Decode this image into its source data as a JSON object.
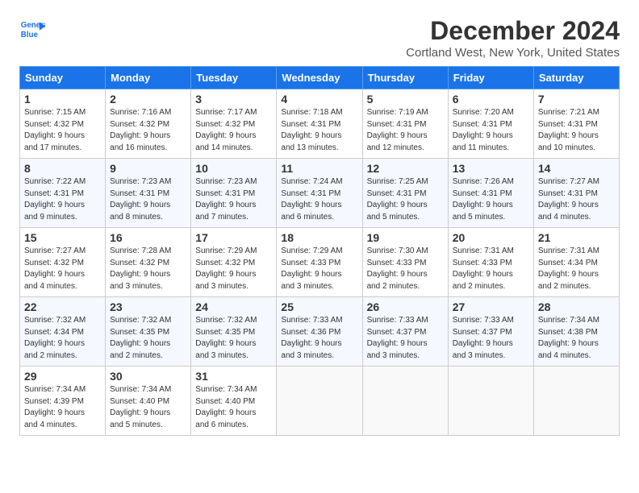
{
  "logo": {
    "line1": "General",
    "line2": "Blue"
  },
  "title": "December 2024",
  "subtitle": "Cortland West, New York, United States",
  "days_of_week": [
    "Sunday",
    "Monday",
    "Tuesday",
    "Wednesday",
    "Thursday",
    "Friday",
    "Saturday"
  ],
  "weeks": [
    [
      {
        "day": 1,
        "info": "Sunrise: 7:15 AM\nSunset: 4:32 PM\nDaylight: 9 hours\nand 17 minutes."
      },
      {
        "day": 2,
        "info": "Sunrise: 7:16 AM\nSunset: 4:32 PM\nDaylight: 9 hours\nand 16 minutes."
      },
      {
        "day": 3,
        "info": "Sunrise: 7:17 AM\nSunset: 4:32 PM\nDaylight: 9 hours\nand 14 minutes."
      },
      {
        "day": 4,
        "info": "Sunrise: 7:18 AM\nSunset: 4:31 PM\nDaylight: 9 hours\nand 13 minutes."
      },
      {
        "day": 5,
        "info": "Sunrise: 7:19 AM\nSunset: 4:31 PM\nDaylight: 9 hours\nand 12 minutes."
      },
      {
        "day": 6,
        "info": "Sunrise: 7:20 AM\nSunset: 4:31 PM\nDaylight: 9 hours\nand 11 minutes."
      },
      {
        "day": 7,
        "info": "Sunrise: 7:21 AM\nSunset: 4:31 PM\nDaylight: 9 hours\nand 10 minutes."
      }
    ],
    [
      {
        "day": 8,
        "info": "Sunrise: 7:22 AM\nSunset: 4:31 PM\nDaylight: 9 hours\nand 9 minutes."
      },
      {
        "day": 9,
        "info": "Sunrise: 7:23 AM\nSunset: 4:31 PM\nDaylight: 9 hours\nand 8 minutes."
      },
      {
        "day": 10,
        "info": "Sunrise: 7:23 AM\nSunset: 4:31 PM\nDaylight: 9 hours\nand 7 minutes."
      },
      {
        "day": 11,
        "info": "Sunrise: 7:24 AM\nSunset: 4:31 PM\nDaylight: 9 hours\nand 6 minutes."
      },
      {
        "day": 12,
        "info": "Sunrise: 7:25 AM\nSunset: 4:31 PM\nDaylight: 9 hours\nand 5 minutes."
      },
      {
        "day": 13,
        "info": "Sunrise: 7:26 AM\nSunset: 4:31 PM\nDaylight: 9 hours\nand 5 minutes."
      },
      {
        "day": 14,
        "info": "Sunrise: 7:27 AM\nSunset: 4:31 PM\nDaylight: 9 hours\nand 4 minutes."
      }
    ],
    [
      {
        "day": 15,
        "info": "Sunrise: 7:27 AM\nSunset: 4:32 PM\nDaylight: 9 hours\nand 4 minutes."
      },
      {
        "day": 16,
        "info": "Sunrise: 7:28 AM\nSunset: 4:32 PM\nDaylight: 9 hours\nand 3 minutes."
      },
      {
        "day": 17,
        "info": "Sunrise: 7:29 AM\nSunset: 4:32 PM\nDaylight: 9 hours\nand 3 minutes."
      },
      {
        "day": 18,
        "info": "Sunrise: 7:29 AM\nSunset: 4:33 PM\nDaylight: 9 hours\nand 3 minutes."
      },
      {
        "day": 19,
        "info": "Sunrise: 7:30 AM\nSunset: 4:33 PM\nDaylight: 9 hours\nand 2 minutes."
      },
      {
        "day": 20,
        "info": "Sunrise: 7:31 AM\nSunset: 4:33 PM\nDaylight: 9 hours\nand 2 minutes."
      },
      {
        "day": 21,
        "info": "Sunrise: 7:31 AM\nSunset: 4:34 PM\nDaylight: 9 hours\nand 2 minutes."
      }
    ],
    [
      {
        "day": 22,
        "info": "Sunrise: 7:32 AM\nSunset: 4:34 PM\nDaylight: 9 hours\nand 2 minutes."
      },
      {
        "day": 23,
        "info": "Sunrise: 7:32 AM\nSunset: 4:35 PM\nDaylight: 9 hours\nand 2 minutes."
      },
      {
        "day": 24,
        "info": "Sunrise: 7:32 AM\nSunset: 4:35 PM\nDaylight: 9 hours\nand 3 minutes."
      },
      {
        "day": 25,
        "info": "Sunrise: 7:33 AM\nSunset: 4:36 PM\nDaylight: 9 hours\nand 3 minutes."
      },
      {
        "day": 26,
        "info": "Sunrise: 7:33 AM\nSunset: 4:37 PM\nDaylight: 9 hours\nand 3 minutes."
      },
      {
        "day": 27,
        "info": "Sunrise: 7:33 AM\nSunset: 4:37 PM\nDaylight: 9 hours\nand 3 minutes."
      },
      {
        "day": 28,
        "info": "Sunrise: 7:34 AM\nSunset: 4:38 PM\nDaylight: 9 hours\nand 4 minutes."
      }
    ],
    [
      {
        "day": 29,
        "info": "Sunrise: 7:34 AM\nSunset: 4:39 PM\nDaylight: 9 hours\nand 4 minutes."
      },
      {
        "day": 30,
        "info": "Sunrise: 7:34 AM\nSunset: 4:40 PM\nDaylight: 9 hours\nand 5 minutes."
      },
      {
        "day": 31,
        "info": "Sunrise: 7:34 AM\nSunset: 4:40 PM\nDaylight: 9 hours\nand 6 minutes."
      },
      null,
      null,
      null,
      null
    ]
  ]
}
